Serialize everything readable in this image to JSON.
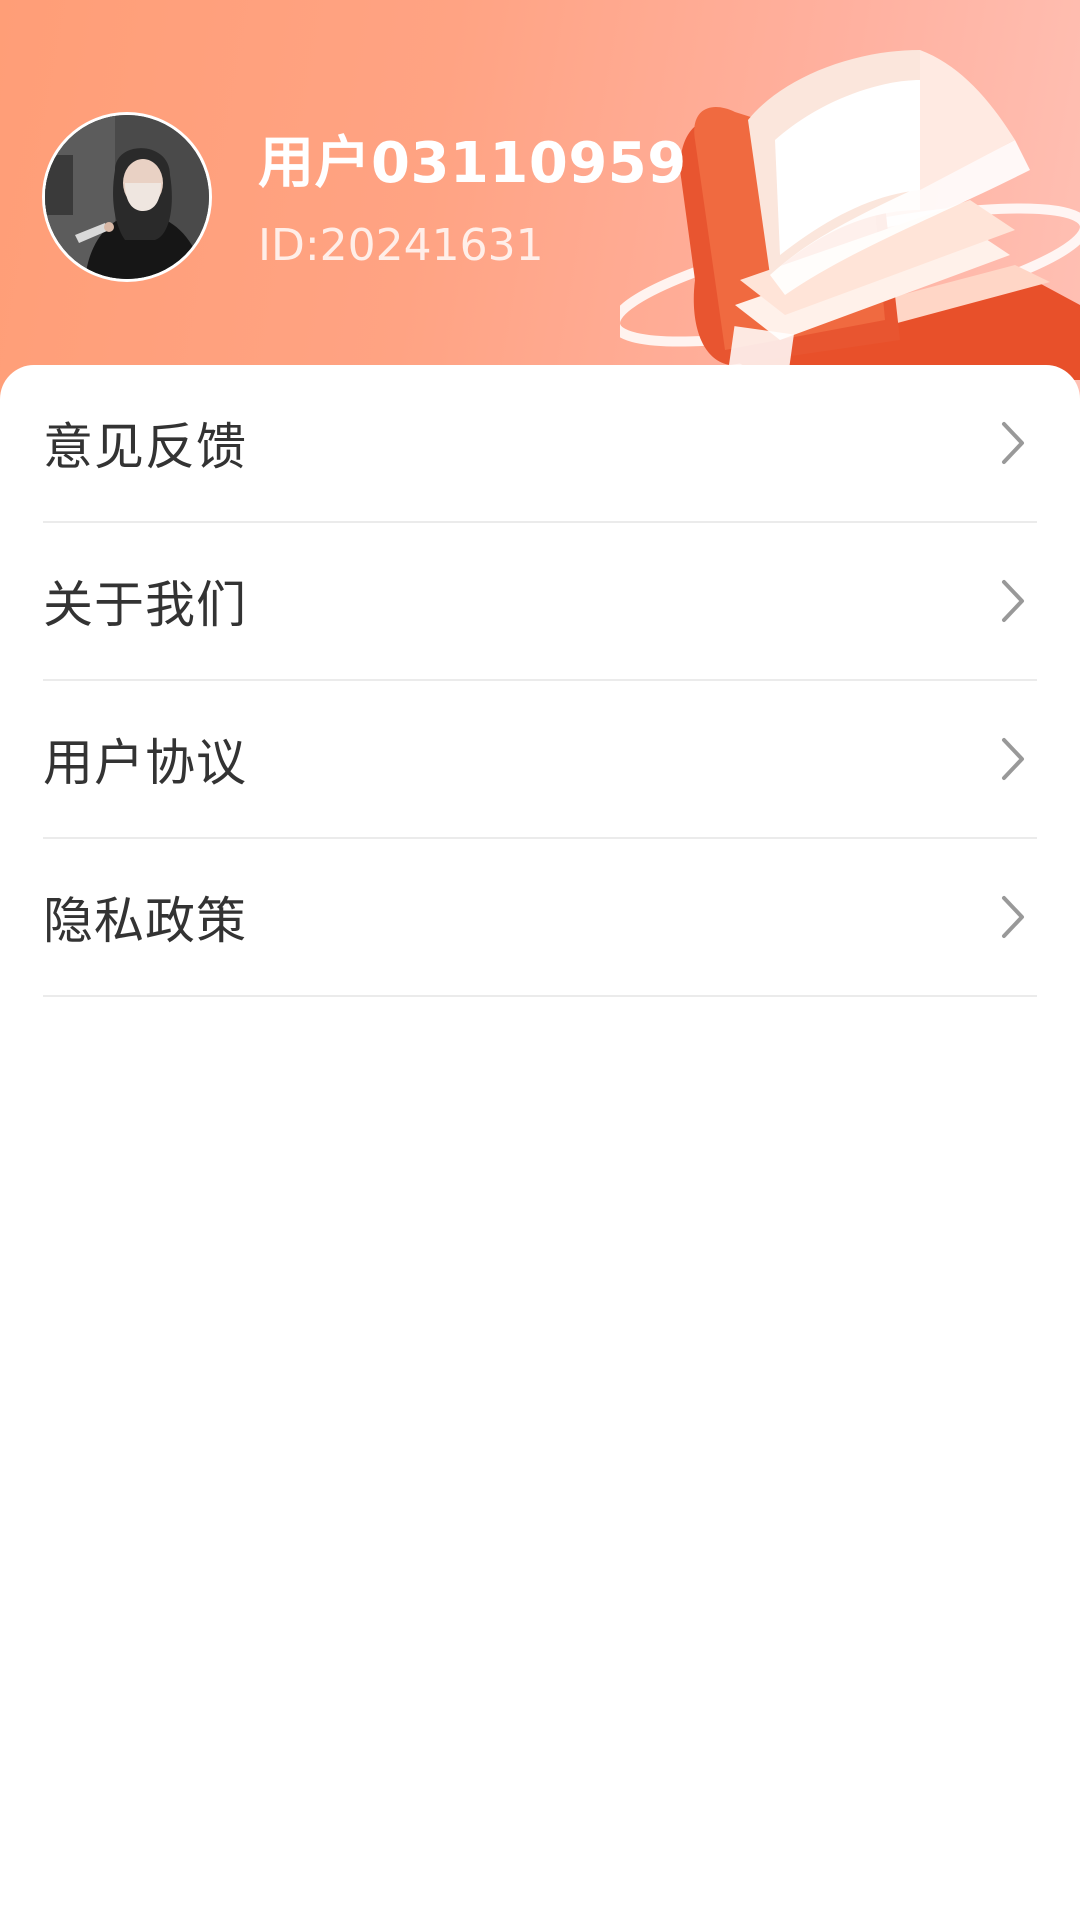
{
  "profile": {
    "username": "用户03110959",
    "user_id": "ID:20241631"
  },
  "menu": {
    "items": [
      {
        "label": "意见反馈",
        "icon": "chevron-right-icon"
      },
      {
        "label": "关于我们",
        "icon": "chevron-right-icon"
      },
      {
        "label": "用户协议",
        "icon": "chevron-right-icon"
      },
      {
        "label": "隐私政策",
        "icon": "chevron-right-icon"
      }
    ]
  },
  "colors": {
    "header_gradient_start": "#ff9e77",
    "header_gradient_end": "#ffc0b4",
    "text_primary": "#333333",
    "divider": "#ebebeb",
    "chevron": "#999999"
  }
}
